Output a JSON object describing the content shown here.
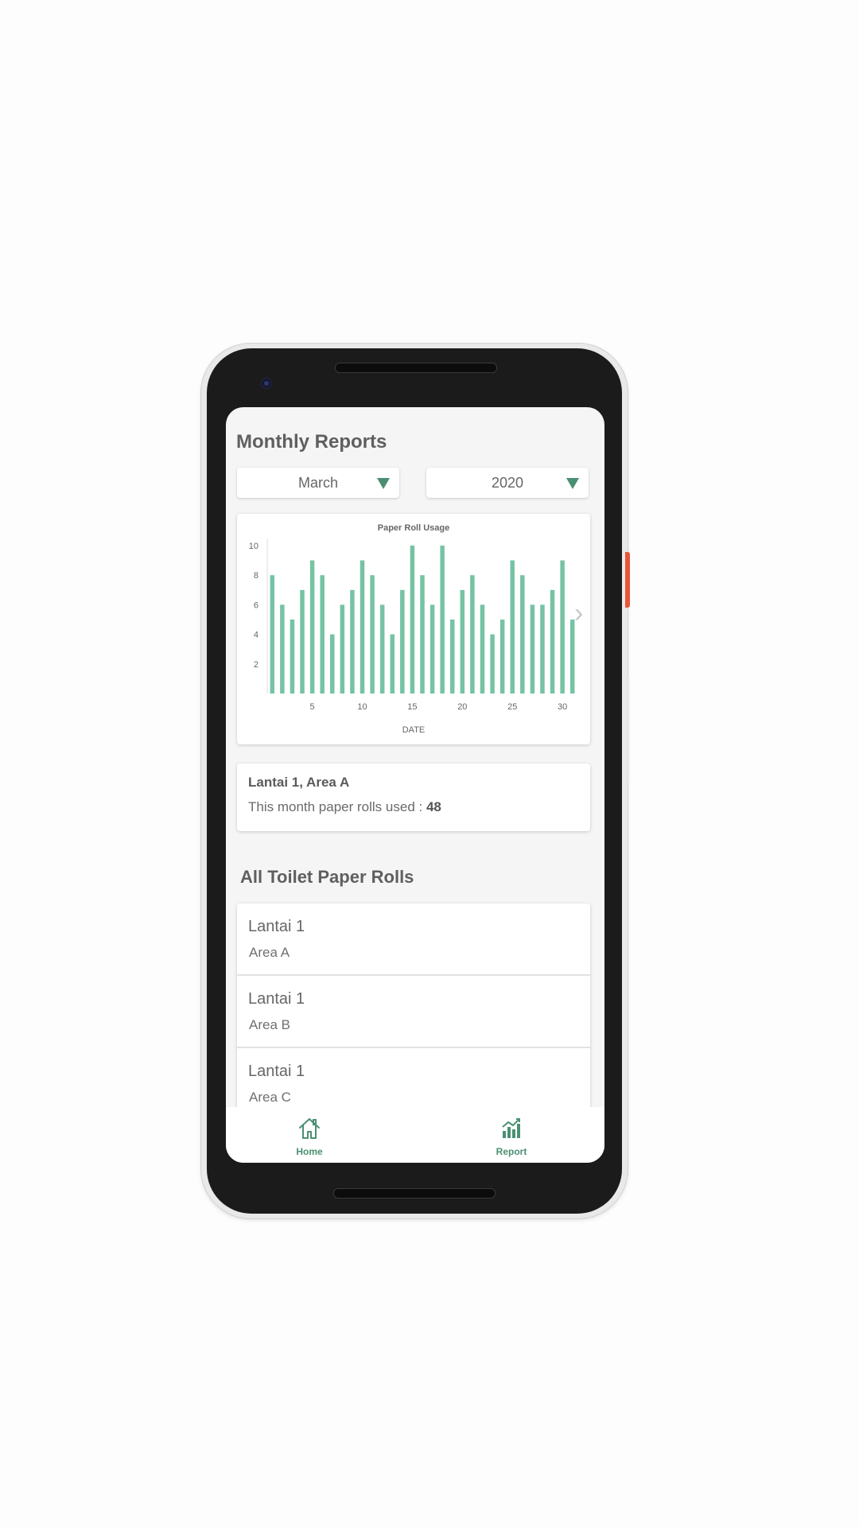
{
  "page": {
    "title": "Monthly Reports"
  },
  "filters": {
    "month": "March",
    "year": "2020"
  },
  "chart_data": {
    "type": "bar",
    "title": "Paper Roll Usage",
    "xlabel": "DATE",
    "ylabel": "",
    "x": [
      1,
      2,
      3,
      4,
      5,
      6,
      7,
      8,
      9,
      10,
      11,
      12,
      13,
      14,
      15,
      16,
      17,
      18,
      19,
      20,
      21,
      22,
      23,
      24,
      25,
      26,
      27,
      28,
      29,
      30,
      31
    ],
    "values": [
      8,
      6,
      5,
      7,
      9,
      8,
      4,
      6,
      7,
      9,
      8,
      6,
      4,
      7,
      10,
      8,
      6,
      10,
      5,
      7,
      8,
      6,
      4,
      5,
      9,
      8,
      6,
      6,
      7,
      9,
      5
    ],
    "xticks": [
      5,
      10,
      15,
      20,
      25,
      30
    ],
    "yticks": [
      2,
      4,
      6,
      8,
      10
    ],
    "ylim": [
      0,
      10
    ],
    "grid": false,
    "bar_color": "#76c3a4"
  },
  "summary": {
    "location": "Lantai 1, Area A",
    "usage_label": "This month paper rolls used : ",
    "usage_value": "48"
  },
  "section_title": "All Toilet Paper Rolls",
  "rolls": [
    {
      "floor": "Lantai 1",
      "area": "Area A"
    },
    {
      "floor": "Lantai 1",
      "area": "Area B"
    },
    {
      "floor": "Lantai 1",
      "area": "Area C"
    }
  ],
  "nav": {
    "home_label": "Home",
    "report_label": "Report",
    "home_icon": "home-icon",
    "report_icon": "chart-icon",
    "accent_color": "#4b8f72"
  }
}
